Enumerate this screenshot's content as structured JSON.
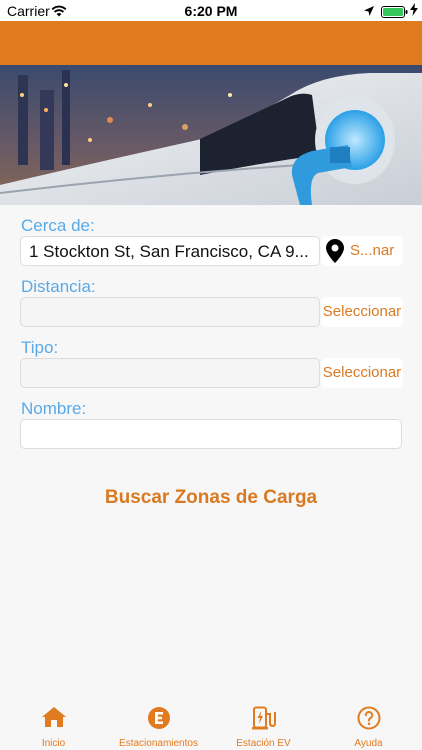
{
  "status_bar": {
    "carrier": "Carrier",
    "time": "6:20 PM",
    "icons": [
      "wifi-icon",
      "location-arrow-icon",
      "battery-icon",
      "charging-bolt-icon"
    ]
  },
  "colors": {
    "accent": "#e07b1f",
    "label_blue": "#5aaae8",
    "button_text": "#d97a23"
  },
  "form": {
    "near_label": "Cerca de:",
    "near_value": "1 Stockton St, San Francisco, CA 9...",
    "near_button": "S...nar",
    "distance_label": "Distancia:",
    "distance_value": "",
    "distance_button": "Seleccionar",
    "type_label": "Tipo:",
    "type_value": "",
    "type_button": "Seleccionar",
    "name_label": "Nombre:",
    "name_value": ""
  },
  "search_button": "Buscar Zonas de Carga",
  "tabs": [
    {
      "label": "Inicio",
      "icon": "home-icon"
    },
    {
      "label": "Estacionamientos",
      "icon": "parking-e-icon"
    },
    {
      "label": "Estación EV",
      "icon": "ev-station-icon"
    },
    {
      "label": "Ayuda",
      "icon": "help-icon"
    }
  ]
}
